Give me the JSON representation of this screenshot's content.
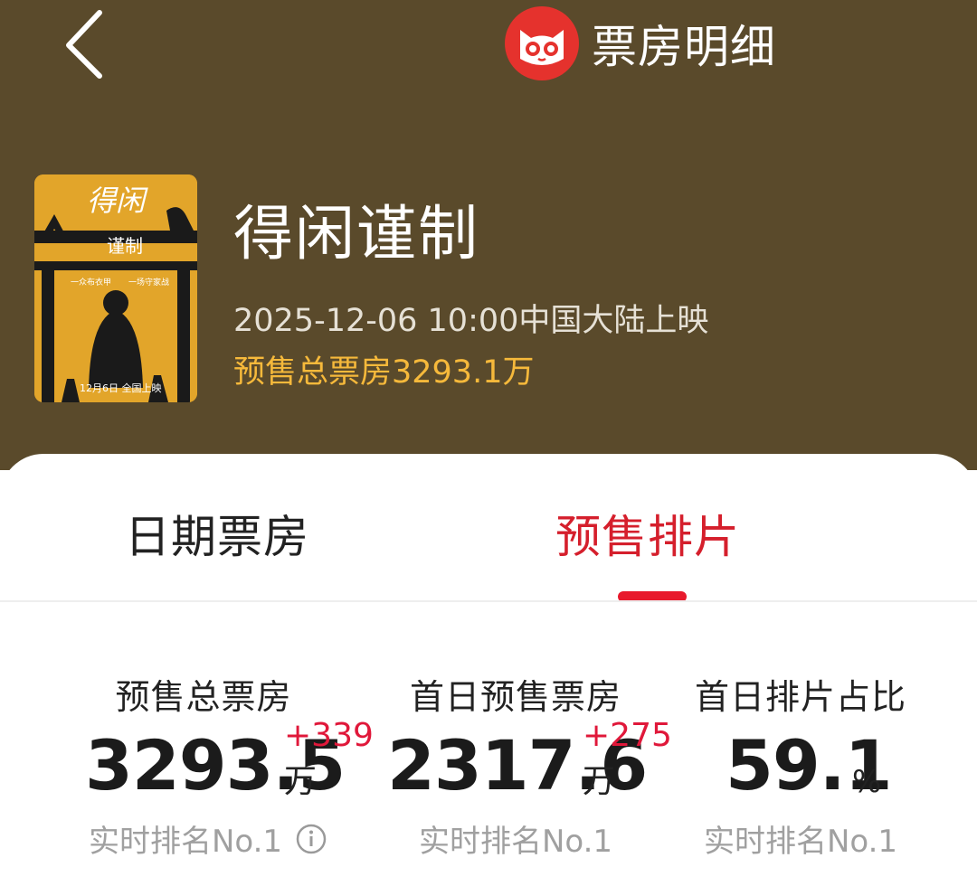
{
  "header": {
    "back_icon": "chevron-left-icon",
    "brand_icon": "cat-logo-icon",
    "title": "票房明细",
    "background": "#5a4a2b"
  },
  "movie": {
    "name": "得闲谨制",
    "release": "2025-12-06 10:00中国大陆上映",
    "presale_total": "预售总票房3293.1万",
    "poster": {
      "title_text": "得闲谨制",
      "tagline_left": "一众布衣甲",
      "tagline_right": "一场守家战",
      "date_text": "12月6日 全国上映"
    }
  },
  "tabs": [
    {
      "label": "日期票房",
      "active": false
    },
    {
      "label": "预售排片",
      "active": true
    }
  ],
  "stats": [
    {
      "label": "预售总票房",
      "value": "3293.5",
      "unit": "万",
      "delta": "+339",
      "rank": "实时排名No.1",
      "info_icon": "info-icon"
    },
    {
      "label": "首日预售票房",
      "value": "2317.6",
      "unit": "万",
      "delta": "+275",
      "rank": "实时排名No.1"
    },
    {
      "label": "首日排片占比",
      "value": "59.1",
      "unit": "%",
      "rank": "实时排名No.1"
    }
  ],
  "colors": {
    "accent": "#e8192c",
    "presale": "#f6b93b"
  }
}
